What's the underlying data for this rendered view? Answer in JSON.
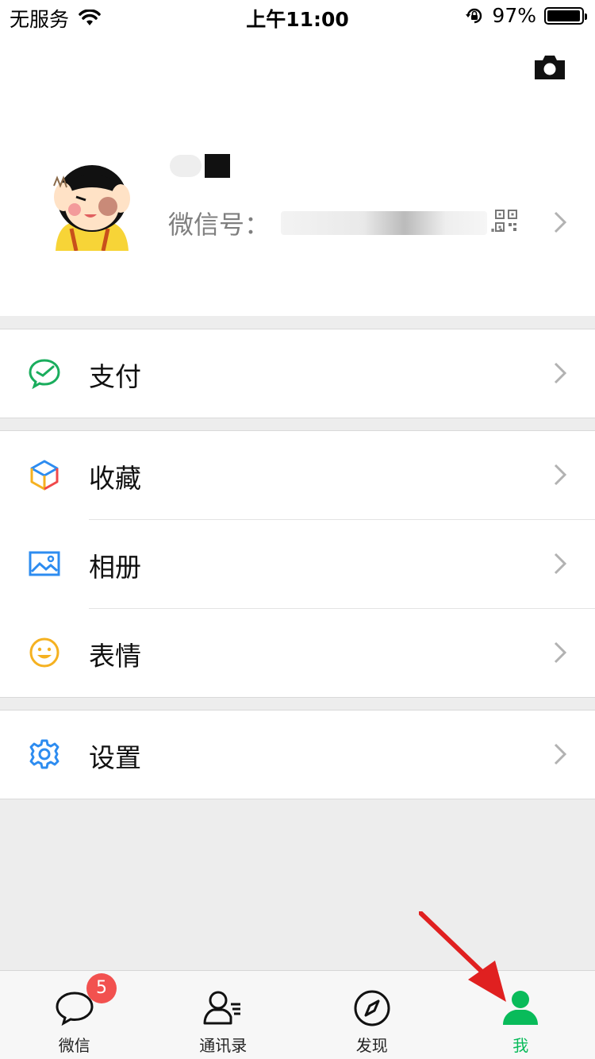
{
  "status_bar": {
    "carrier": "无服务",
    "time": "上午11:00",
    "battery": "97%",
    "battery_level": 0.97
  },
  "profile": {
    "wechat_id_label": "微信号：",
    "wechat_id_ellipsis": ".."
  },
  "menu": {
    "pay": "支付",
    "favorites": "收藏",
    "album": "相册",
    "stickers": "表情",
    "settings": "设置"
  },
  "tabbar": {
    "chats": "微信",
    "chats_badge": "5",
    "contacts": "通讯录",
    "discover": "发现",
    "me": "我",
    "active": "me"
  },
  "colors": {
    "accent_green": "#09bb5a",
    "badge_red": "#f2514f",
    "annotation_arrow": "#e02020"
  }
}
